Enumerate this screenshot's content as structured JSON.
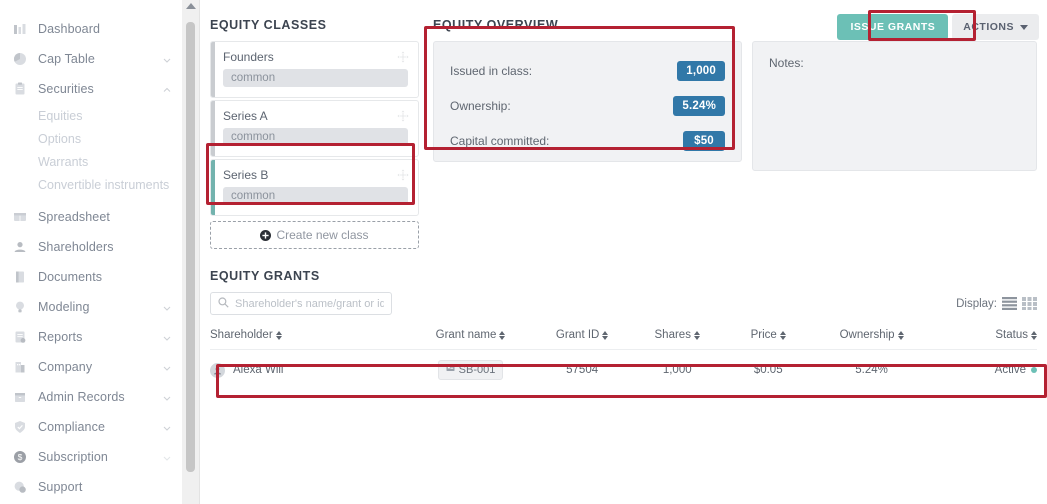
{
  "sidebar": {
    "items": [
      {
        "label": "Dashboard",
        "icon": "bar-chart-icon",
        "expandable": false,
        "active": false
      },
      {
        "label": "Cap Table",
        "icon": "pie-chart-icon",
        "expandable": true,
        "expanded": false
      },
      {
        "label": "Securities",
        "icon": "clipboard-icon",
        "expandable": true,
        "expanded": true
      },
      {
        "label": "Spreadsheet",
        "icon": "table-icon",
        "expandable": false
      },
      {
        "label": "Shareholders",
        "icon": "people-icon",
        "expandable": false
      },
      {
        "label": "Documents",
        "icon": "document-icon",
        "expandable": false
      },
      {
        "label": "Modeling",
        "icon": "lightbulb-icon",
        "expandable": true
      },
      {
        "label": "Reports",
        "icon": "report-icon",
        "expandable": true
      },
      {
        "label": "Company",
        "icon": "building-icon",
        "expandable": true
      },
      {
        "label": "Admin Records",
        "icon": "archive-icon",
        "expandable": true
      },
      {
        "label": "Compliance",
        "icon": "shield-check-icon",
        "expandable": true
      },
      {
        "label": "Subscription",
        "icon": "dollar-circle-icon",
        "expandable": true
      },
      {
        "label": "Support",
        "icon": "support-icon",
        "expandable": false
      }
    ],
    "securities_sub": [
      {
        "label": "Equities"
      },
      {
        "label": "Options"
      },
      {
        "label": "Warrants"
      },
      {
        "label": "Convertible instruments"
      }
    ]
  },
  "header": {
    "issue_grants_label": "ISSUE GRANTS",
    "actions_label": "ACTIONS"
  },
  "equity_classes": {
    "title": "EQUITY CLASSES",
    "items": [
      {
        "name": "Founders",
        "type": "common",
        "selected": false
      },
      {
        "name": "Series A",
        "type": "common",
        "selected": false
      },
      {
        "name": "Series B",
        "type": "common",
        "selected": true
      }
    ],
    "create_label": "Create new class"
  },
  "equity_overview": {
    "title": "EQUITY OVERVIEW",
    "rows": [
      {
        "label": "Issued in class:",
        "value": "1,000"
      },
      {
        "label": "Ownership:",
        "value": "5.24%"
      },
      {
        "label": "Capital committed:",
        "value": "$50"
      }
    ]
  },
  "notes": {
    "label": "Notes:",
    "value": ""
  },
  "equity_grants": {
    "title": "EQUITY GRANTS",
    "search_placeholder": "Shareholder's name/grant or id",
    "search_value": "",
    "display_label": "Display:",
    "columns": [
      "Shareholder",
      "Grant name",
      "Grant ID",
      "Shares",
      "Price",
      "Ownership",
      "Status"
    ],
    "rows": [
      {
        "shareholder": "Alexa Will",
        "grant_name": "SB-001",
        "grant_id": "57504",
        "shares": "1,000",
        "price": "$0.05",
        "ownership": "5.24%",
        "status": "Active"
      }
    ]
  },
  "colors": {
    "accent_teal": "#6cc0b6",
    "badge_blue": "#3178a8",
    "highlight_red": "#b42132",
    "status_active": "#6cc0b6"
  }
}
